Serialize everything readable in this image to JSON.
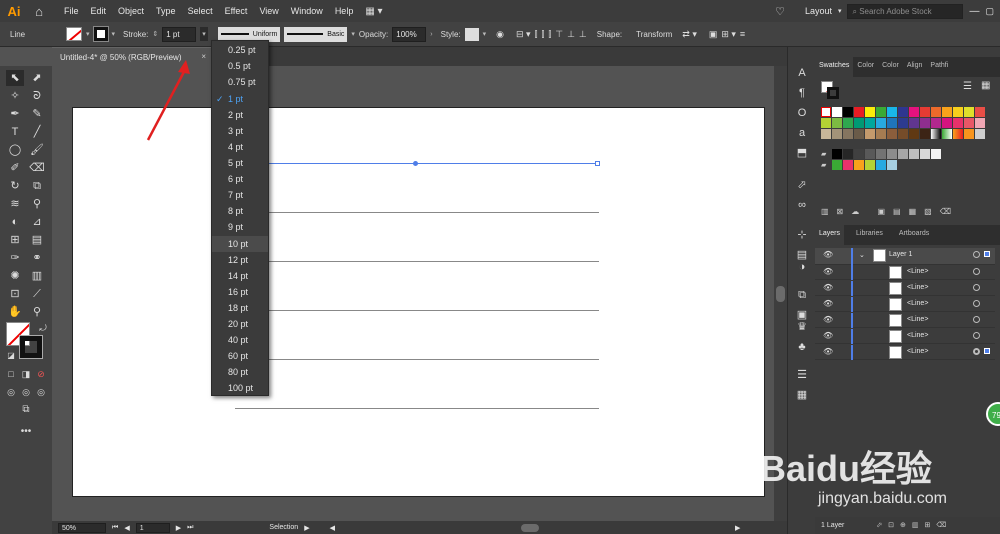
{
  "app": {
    "logo": "Ai",
    "workspace": "Layout",
    "search_placeholder": "Search Adobe Stock"
  },
  "menu": [
    "File",
    "Edit",
    "Object",
    "Type",
    "Select",
    "Effect",
    "View",
    "Window",
    "Help"
  ],
  "control": {
    "object_type": "Line",
    "stroke_label": "Stroke:",
    "stroke_value": "1 pt",
    "profile_label": "Uniform",
    "brush_label": "Basic",
    "opacity_label": "Opacity:",
    "opacity_value": "100%",
    "style_label": "Style:",
    "shape_label": "Shape:",
    "transform_label": "Transform"
  },
  "document": {
    "tab_title": "Untitled-4* @ 50% (RGB/Preview)",
    "close": "×"
  },
  "stroke_menu": {
    "options": [
      "0.25 pt",
      "0.5 pt",
      "0.75 pt",
      "1 pt",
      "2 pt",
      "3 pt",
      "4 pt",
      "5 pt",
      "6 pt",
      "7 pt",
      "8 pt",
      "9 pt",
      "10 pt",
      "12 pt",
      "14 pt",
      "16 pt",
      "18 pt",
      "20 pt",
      "40 pt",
      "60 pt",
      "80 pt",
      "100 pt"
    ],
    "selected": "1 pt",
    "hovered": "10 pt"
  },
  "status": {
    "zoom": "50%",
    "page": "1",
    "tool": "Selection"
  },
  "panels": {
    "tabs_top": [
      "Swatches",
      "Color",
      "Color",
      "Align",
      "Pathfi"
    ],
    "tabs_layers": [
      "Layers",
      "Libraries",
      "Artboards"
    ],
    "layer_name": "Layer 1",
    "sublayers": [
      "<Line>",
      "<Line>",
      "<Line>",
      "<Line>",
      "<Line>",
      "<Line>"
    ],
    "footer": "1 Layer"
  },
  "watermark": {
    "brand": "Baidu经验",
    "url": "jingyan.baidu.com",
    "badge": "79"
  },
  "colors": {
    "accent": "#4f7ee8",
    "arrow": "#e02020",
    "logo": "#ff9a00"
  }
}
